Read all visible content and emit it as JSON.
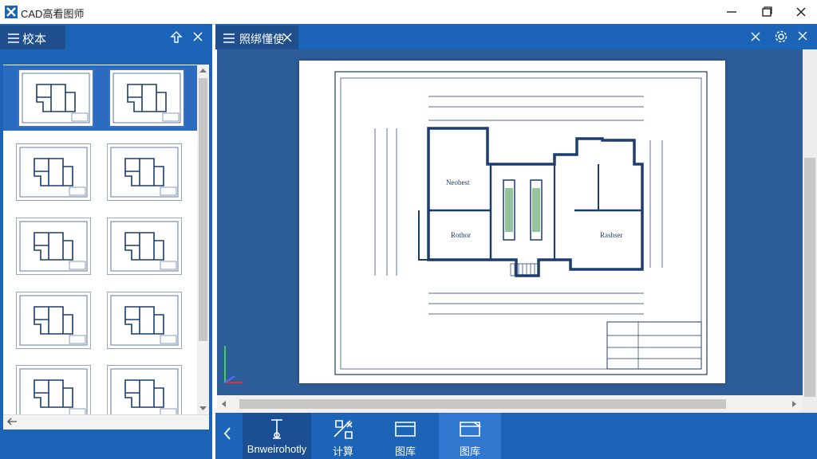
{
  "window": {
    "title": "CAD高看图师",
    "minimize_icon": "minimize-icon",
    "maximize_icon": "restore-icon",
    "close_icon": "close-icon"
  },
  "left_panel": {
    "tab_label": "校本",
    "icons": [
      "menu-icon",
      "pin-icon",
      "close-icon"
    ],
    "thumbnails": 10,
    "selected_row": 0
  },
  "main_panel": {
    "tab_label": "照绑懂使",
    "icons": [
      "menu-icon",
      "close-icon",
      "settings-icon",
      "close-icon"
    ]
  },
  "drawing": {
    "room_labels": [
      "Neobest",
      "Rothor",
      "Rashser"
    ]
  },
  "toolbar": {
    "items": [
      {
        "label": "Bnweirohotly",
        "icon": "measure-icon",
        "state": "dark"
      },
      {
        "label": "计算",
        "icon": "calculate-icon",
        "state": "normal"
      },
      {
        "label": "图库",
        "icon": "library-icon",
        "state": "normal"
      },
      {
        "label": "图库",
        "icon": "library-icon",
        "state": "active"
      }
    ]
  },
  "colors": {
    "accent": "#1b64b8",
    "tab_dark": "#1f4f8c",
    "canvas": "#2d5d99",
    "active_tool": "#2f77cf"
  }
}
